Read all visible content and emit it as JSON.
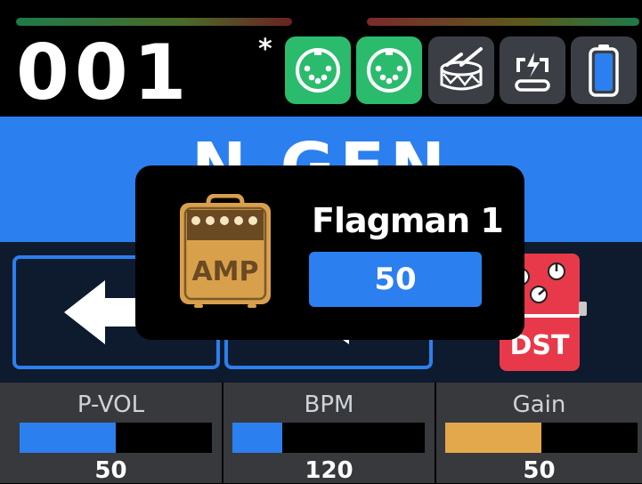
{
  "header": {
    "preset_number": "001",
    "modified_marker": "*",
    "status_icons": [
      {
        "name": "midi-in-icon",
        "color": "#2bbb6c"
      },
      {
        "name": "midi-out-icon",
        "color": "#2bbb6c"
      },
      {
        "name": "drum-icon",
        "color": "#3b3f45"
      },
      {
        "name": "usb-power-icon",
        "color": "#3b3f45"
      },
      {
        "name": "battery-icon",
        "color": "#3b3f45"
      }
    ]
  },
  "preset": {
    "name": "N   GEN"
  },
  "popup": {
    "icon": "amp-icon",
    "icon_label": "AMP",
    "title": "Flagman 1",
    "value": "50"
  },
  "pedal": {
    "label": "DST",
    "color": "#e8394a"
  },
  "params": [
    {
      "label": "P-VOL",
      "value": "50",
      "fill": 0.5,
      "color": "#2c7fee"
    },
    {
      "label": "BPM",
      "value": "120",
      "fill": 0.26,
      "color": "#2c7fee"
    },
    {
      "label": "Gain",
      "value": "50",
      "fill": 0.5,
      "color": "#e3a84c"
    }
  ],
  "colors": {
    "accent_blue": "#2c7fee",
    "midi_green": "#2bbb6c",
    "amp_tan": "#d9a04c"
  }
}
